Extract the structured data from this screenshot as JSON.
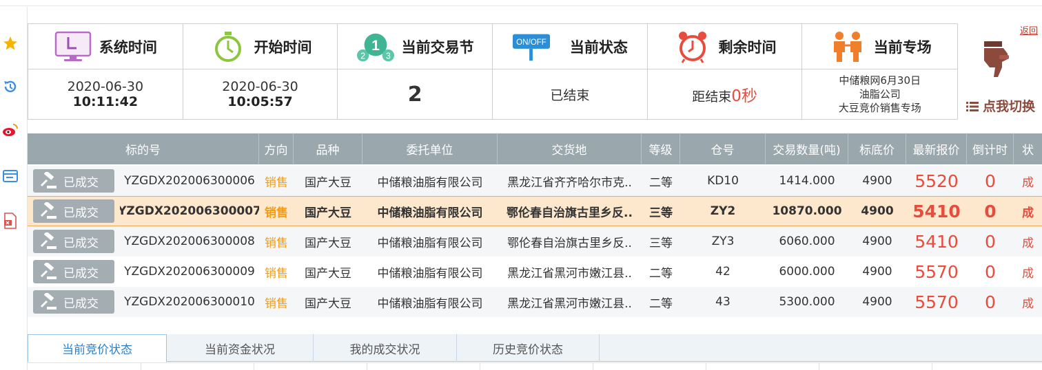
{
  "back_link": "返回",
  "info": {
    "system_time": {
      "title": "系统时间",
      "date": "2020-06-30",
      "time": "10:11:42"
    },
    "start_time": {
      "title": "开始时间",
      "date": "2020-06-30",
      "time": "10:05:57"
    },
    "session": {
      "title": "当前交易节",
      "value": "2",
      "icon_labels": [
        "2",
        "1",
        "3"
      ]
    },
    "status": {
      "title": "当前状态",
      "value": "已结束",
      "icon_label": "ON/OFF"
    },
    "remaining": {
      "title": "剩余时间",
      "prefix": "距结束",
      "value": "0秒"
    },
    "venue": {
      "title": "当前专场",
      "lines": [
        "中储粮网6月30日",
        "油脂公司",
        "大豆竞价销售专场"
      ]
    }
  },
  "switch_label": "点我切换",
  "table": {
    "headers": [
      "标的号",
      "方向",
      "品种",
      "委托单位",
      "交货地",
      "等级",
      "仓号",
      "交易数量(吨)",
      "标底价",
      "最新报价",
      "倒计时",
      "状"
    ],
    "done_label": "已成交",
    "rows": [
      {
        "id": "YZGDX202006300006",
        "direction": "销售",
        "variety": "国产大豆",
        "client": "中储粮油脂有限公司",
        "place": "黑龙江省齐齐哈尔市克..",
        "grade": "二等",
        "warehouse": "KD10",
        "qty": "1414.000",
        "base": "4900",
        "price": "5520",
        "countdown": "0",
        "status": "成"
      },
      {
        "id": "YZGDX202006300007",
        "direction": "销售",
        "variety": "国产大豆",
        "client": "中储粮油脂有限公司",
        "place": "鄂伦春自治旗古里乡反..",
        "grade": "三等",
        "warehouse": "ZY2",
        "qty": "10870.000",
        "base": "4900",
        "price": "5410",
        "countdown": "0",
        "status": "成"
      },
      {
        "id": "YZGDX202006300008",
        "direction": "销售",
        "variety": "国产大豆",
        "client": "中储粮油脂有限公司",
        "place": "鄂伦春自治旗古里乡反..",
        "grade": "三等",
        "warehouse": "ZY3",
        "qty": "6060.000",
        "base": "4900",
        "price": "5410",
        "countdown": "0",
        "status": "成"
      },
      {
        "id": "YZGDX202006300009",
        "direction": "销售",
        "variety": "国产大豆",
        "client": "中储粮油脂有限公司",
        "place": "黑龙江省黑河市嫩江县..",
        "grade": "二等",
        "warehouse": "42",
        "qty": "6000.000",
        "base": "4900",
        "price": "5570",
        "countdown": "0",
        "status": "成"
      },
      {
        "id": "YZGDX202006300010",
        "direction": "销售",
        "variety": "国产大豆",
        "client": "中储粮油脂有限公司",
        "place": "黑龙江省黑河市嫩江县..",
        "grade": "二等",
        "warehouse": "43",
        "qty": "5300.000",
        "base": "4900",
        "price": "5570",
        "countdown": "0",
        "status": "成"
      }
    ]
  },
  "tabs": [
    "当前竞价状态",
    "当前资金状况",
    "我的成交状况",
    "历史竞价状态"
  ],
  "colors": {
    "header_bg": "#9aa7ad",
    "accent_red": "#e74c3c",
    "direction_orange": "#f39c12",
    "tab_blue": "#2f7fc5",
    "selected_row": "#fde8cd"
  }
}
